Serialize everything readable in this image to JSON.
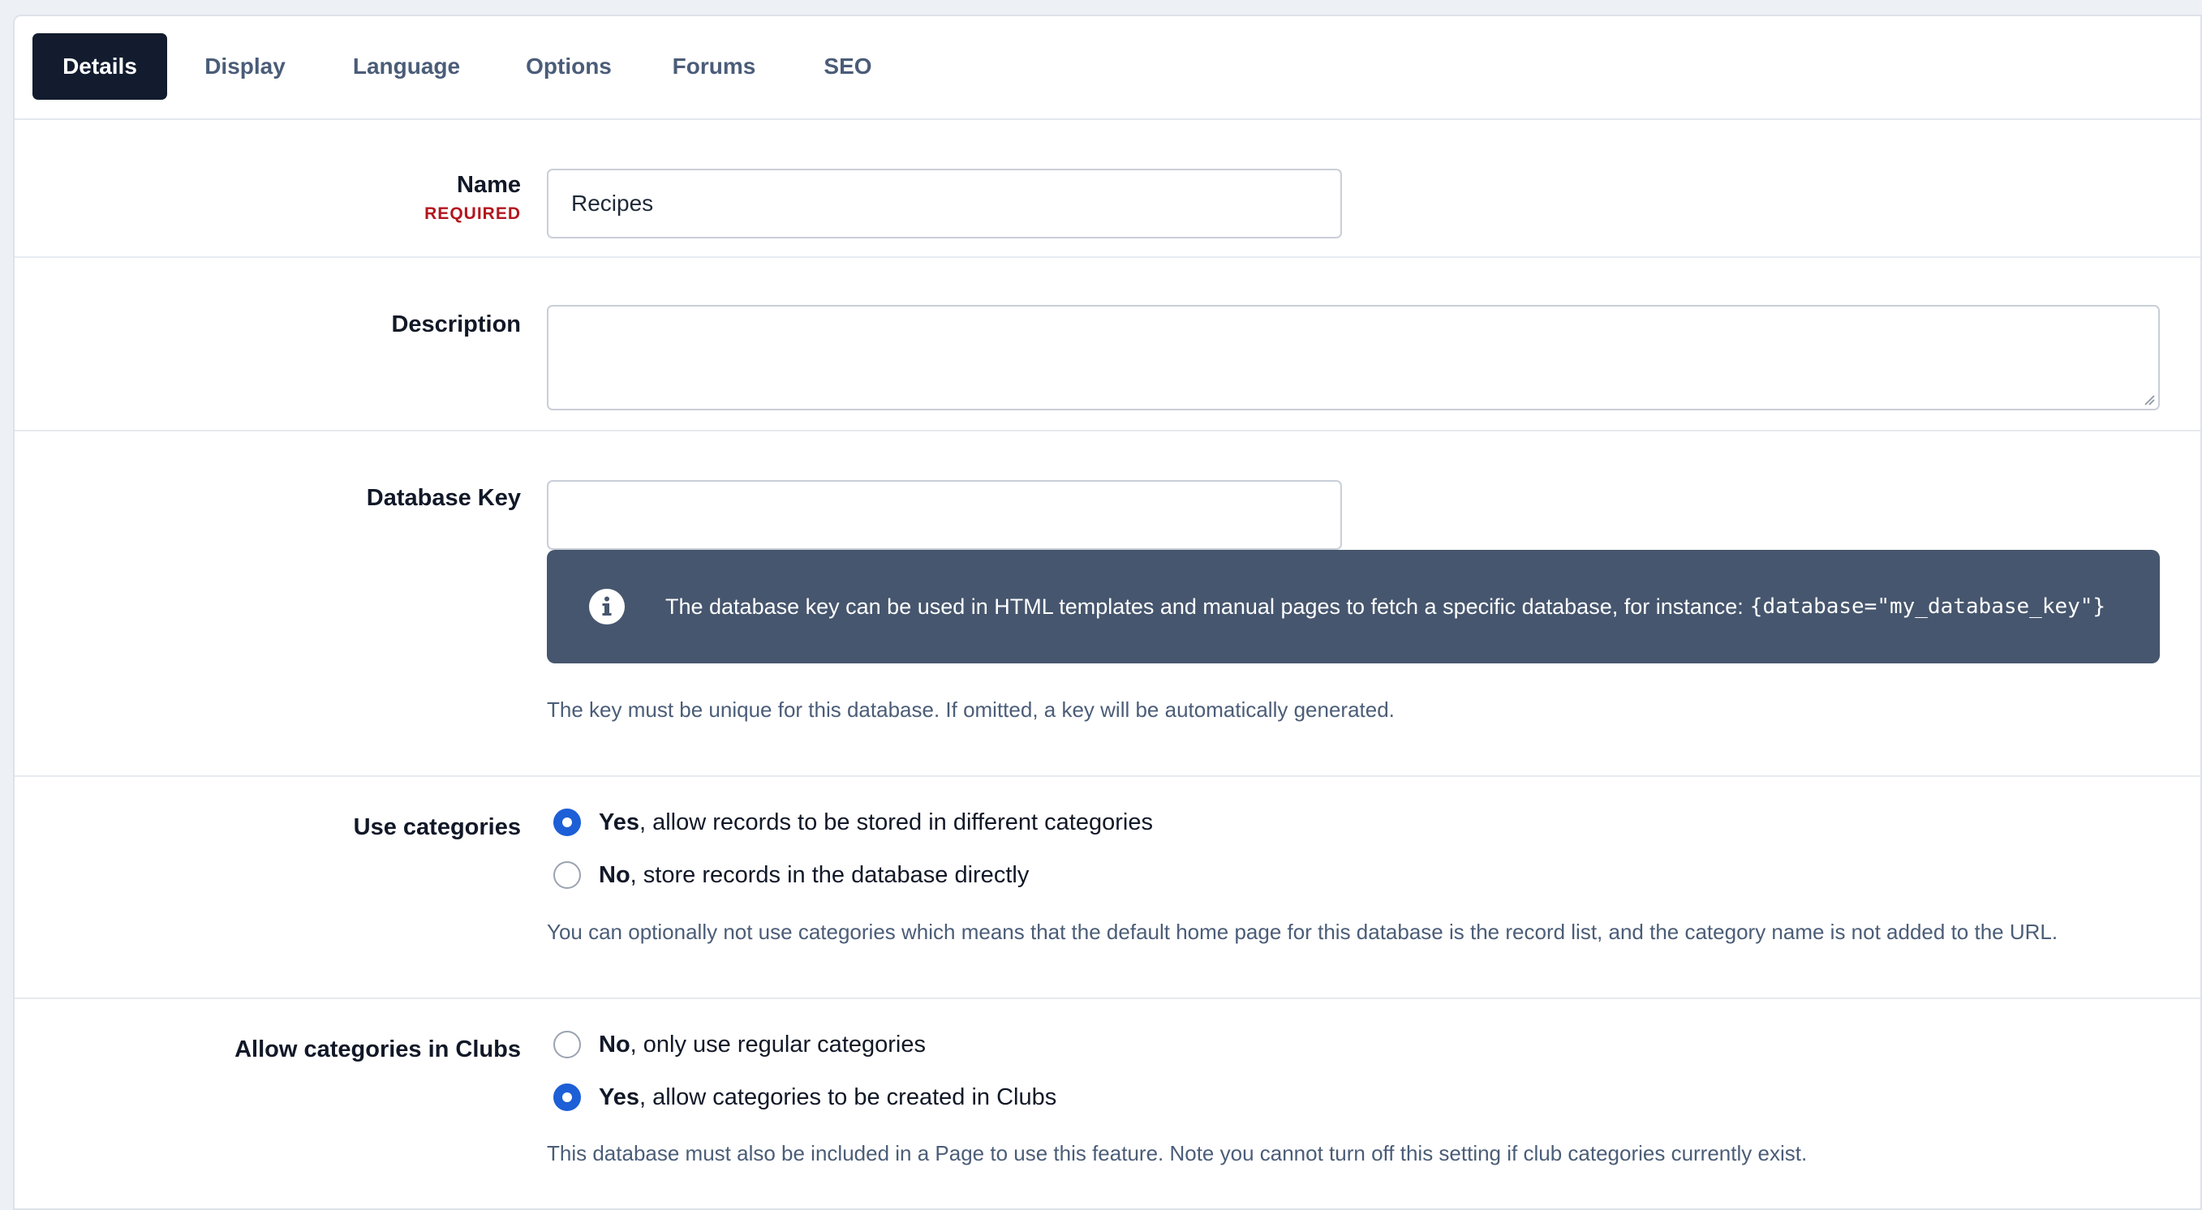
{
  "tabs": [
    {
      "label": "Details",
      "active": true
    },
    {
      "label": "Display"
    },
    {
      "label": "Language"
    },
    {
      "label": "Options"
    },
    {
      "label": "Forums"
    },
    {
      "label": "SEO"
    }
  ],
  "name_field": {
    "label": "Name",
    "required": "REQUIRED",
    "value": "Recipes"
  },
  "description_field": {
    "label": "Description",
    "value": ""
  },
  "database_key_field": {
    "label": "Database Key",
    "value": "",
    "info_text": "The database key can be used in HTML templates and manual pages to fetch a specific database, for instance:",
    "info_code": "{database=\"my_database_key\"}",
    "help": "The key must be unique for this database. If omitted, a key will be automatically generated."
  },
  "use_categories": {
    "label": "Use categories",
    "options": [
      {
        "bold": "Yes",
        "rest": ", allow records to be stored in different categories",
        "selected": true
      },
      {
        "bold": "No",
        "rest": ", store records in the database directly",
        "selected": false
      }
    ],
    "help": "You can optionally not use categories which means that the default home page for this database is the record list, and the category name is not added to the URL."
  },
  "club_categories": {
    "label": "Allow categories in Clubs",
    "options": [
      {
        "bold": "No",
        "rest": ", only use regular categories",
        "selected": false
      },
      {
        "bold": "Yes",
        "rest": ", allow categories to be created in Clubs",
        "selected": true
      }
    ],
    "help": "This database must also be included in a Page to use this feature. Note you cannot turn off this setting if club categories currently exist."
  },
  "colors": {
    "active_tab": "#121c2e",
    "radio_selected": "#1d5fd6",
    "info_bg": "#46566e",
    "required": "#b3161e"
  }
}
